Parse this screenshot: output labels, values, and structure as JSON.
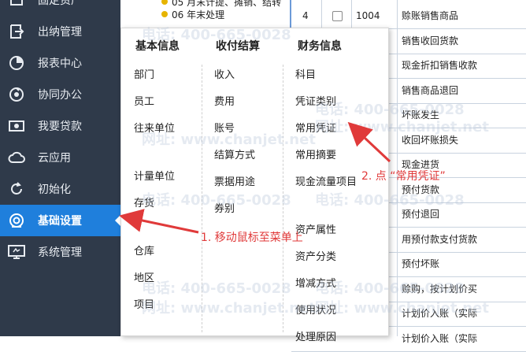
{
  "sidebar": {
    "items": [
      {
        "label": "固定资产",
        "icon": "asset-icon"
      },
      {
        "label": "出纳管理",
        "icon": "cashier-icon"
      },
      {
        "label": "报表中心",
        "icon": "report-icon"
      },
      {
        "label": "协同办公",
        "icon": "collaboration-icon"
      },
      {
        "label": "我要贷款",
        "icon": "loan-icon"
      },
      {
        "label": "云应用",
        "icon": "cloud-icon"
      },
      {
        "label": "初始化",
        "icon": "refresh-icon"
      },
      {
        "label": "基础设置",
        "icon": "settings-icon",
        "active": true
      },
      {
        "label": "系统管理",
        "icon": "system-icon"
      }
    ]
  },
  "tree": {
    "items": [
      {
        "label": "05 月末计提、摊销、结转"
      },
      {
        "label": "06 年末处理"
      }
    ]
  },
  "grid": {
    "rows": [
      {
        "no": "4",
        "code": "1004",
        "name": "赊账销售商品"
      },
      {
        "no": "",
        "code": "",
        "name": "销售收回货款"
      },
      {
        "no": "",
        "code": "",
        "name": "现金折扣销售收款"
      },
      {
        "no": "",
        "code": "",
        "name": "销售商品退回"
      },
      {
        "no": "",
        "code": "",
        "name": "坏账发生"
      },
      {
        "no": "",
        "code": "",
        "name": "收回坏账损失"
      },
      {
        "no": "",
        "code": "",
        "name": "现金进货"
      },
      {
        "no": "",
        "code": "",
        "name": "预付货款"
      },
      {
        "no": "",
        "code": "",
        "name": "预付退回"
      },
      {
        "no": "",
        "code": "",
        "name": "用预付款支付货款"
      },
      {
        "no": "",
        "code": "",
        "name": "预付坏账"
      },
      {
        "no": "",
        "code": "",
        "name": "赊购，按计划价买"
      },
      {
        "no": "",
        "code": "",
        "name": "计划价入账（实际"
      },
      {
        "no": "",
        "code": "",
        "name": "计划价入账（实际"
      }
    ]
  },
  "menu": {
    "columns": [
      {
        "title": "基本信息",
        "items": [
          "部门",
          "员工",
          "往来单位",
          "计量单位",
          "存货",
          "仓库",
          "地区",
          "项目"
        ]
      },
      {
        "title": "收付结算",
        "items": [
          "收入",
          "费用",
          "账号",
          "结算方式",
          "票据用途",
          "券别"
        ]
      },
      {
        "title": "财务信息",
        "items": [
          "科目",
          "凭证类别",
          "常用凭证",
          "常用摘要",
          "现金流量项目",
          "资产属性",
          "资产分类",
          "增减方式",
          "使用状况",
          "处理原因"
        ]
      }
    ]
  },
  "annotations": {
    "step1": "1. 移动鼠标至菜单上",
    "step2": "2. 点 “常用凭证”",
    "color": "#e03a3a"
  },
  "watermark": {
    "phone": "电话: 400-665-0028",
    "site": "网址: www.chanjet.net"
  },
  "colors": {
    "sidebar_bg": "#2f3a4a",
    "active_bg": "#1f7fdc",
    "annotation": "#e03a3a"
  }
}
